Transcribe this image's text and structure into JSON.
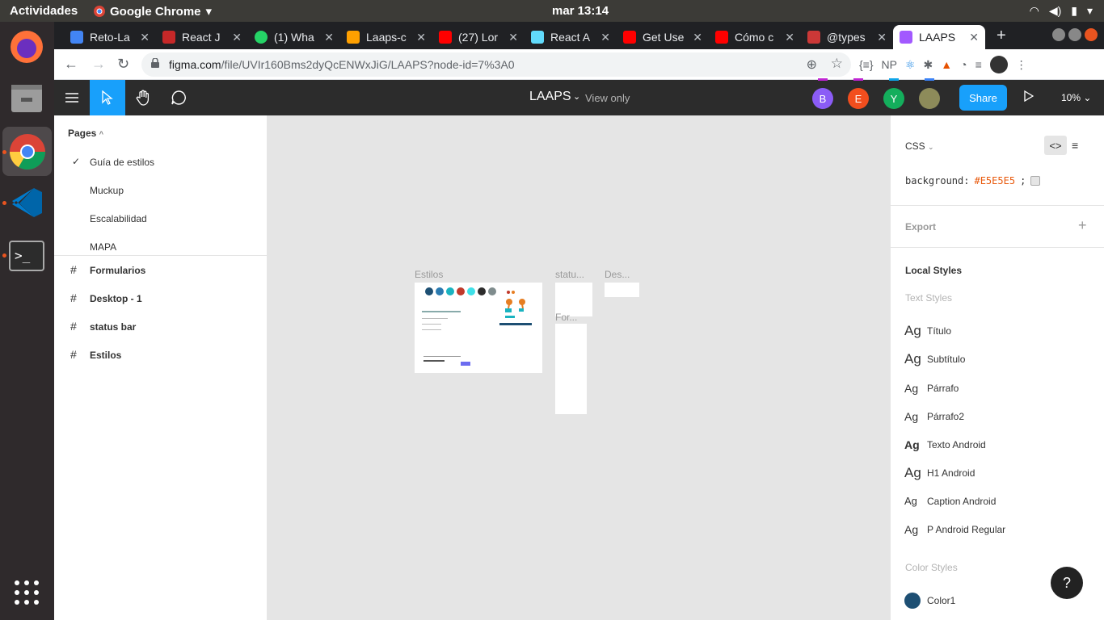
{
  "topbar": {
    "activities": "Actividades",
    "app": "Google Chrome",
    "clock": "mar 13:14"
  },
  "tabs": [
    {
      "title": "Reto-La",
      "color": "#4285f4"
    },
    {
      "title": "React J",
      "color": "#c62828"
    },
    {
      "title": "(1) Wha",
      "color": "#25d366"
    },
    {
      "title": "Laaps-c",
      "color": "#ffa000"
    },
    {
      "title": "(27) Lor",
      "color": "#ff0000"
    },
    {
      "title": "React A",
      "color": "#61dafb"
    },
    {
      "title": "Get Use",
      "color": "#ff0000"
    },
    {
      "title": "Cómo c",
      "color": "#ff0000"
    },
    {
      "title": "@types",
      "color": "#cb3837"
    },
    {
      "title": "LAAPS",
      "color": "#a259ff"
    }
  ],
  "address": {
    "host": "figma.com",
    "path": "/file/UVIr160Bms2dyQcENWxJiG/LAAPS?node-id=7%3A0"
  },
  "extensions": [
    "{≡}",
    "NP"
  ],
  "figma": {
    "file_name": "LAAPS",
    "view_mode": "View only",
    "avatars": [
      {
        "letter": "B",
        "color": "#8b5cf6",
        "bar": "#c026d3"
      },
      {
        "letter": "E",
        "color": "#f24e1e",
        "bar": "#c026d3"
      },
      {
        "letter": "Y",
        "color": "#14ae5c",
        "bar": "#0ea5e9"
      }
    ],
    "share_label": "Share",
    "zoom": "10%"
  },
  "left_panel": {
    "pages_title": "Pages",
    "pages": [
      "Guía de estilos",
      "Muckup",
      "Escalabilidad",
      "MAPA"
    ],
    "layers": [
      "Formularios",
      "Desktop - 1",
      "status bar",
      "Estilos"
    ]
  },
  "canvas": {
    "labels": [
      "Estilos",
      "statu...",
      "Des...",
      "For..."
    ],
    "swatches": [
      "#1d4f73",
      "#2a7ab0",
      "#1ab3c0",
      "#c0392b",
      "#3fe0e8",
      "#2c2c2c",
      "#7f8c8d"
    ]
  },
  "right_panel": {
    "css_title": "CSS",
    "css_prop": "background:",
    "css_value": "#E5E5E5",
    "css_semi": ";",
    "export_label": "Export",
    "local_styles": "Local Styles",
    "text_styles_label": "Text Styles",
    "text_styles": [
      "Título",
      "Subtítulo",
      "Párrafo",
      "Párrafo2",
      "Texto Android",
      "H1 Android",
      "Caption Android",
      "P Android Regular"
    ],
    "color_styles_label": "Color Styles",
    "color1_name": "Color1",
    "color1_value": "#1d4f73",
    "ag": "Ag"
  },
  "help": "?"
}
